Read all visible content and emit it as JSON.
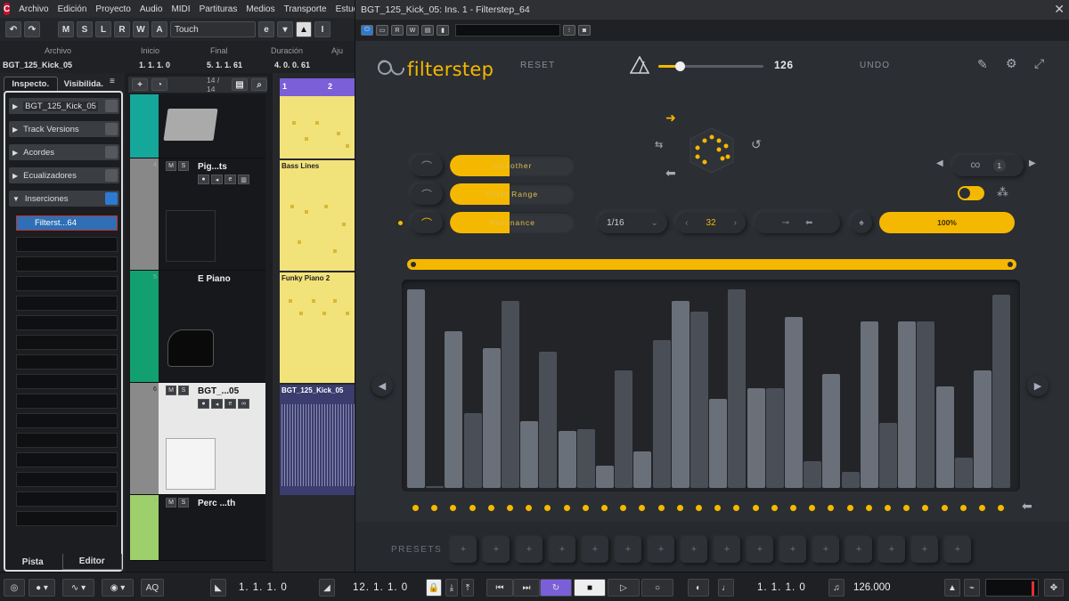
{
  "menu": {
    "items": [
      "Archivo",
      "Edición",
      "Proyecto",
      "Audio",
      "MIDI",
      "Partituras",
      "Medios",
      "Transporte",
      "Estud"
    ]
  },
  "toolbar": {
    "buttons": [
      "M",
      "S",
      "L",
      "R",
      "W",
      "A"
    ],
    "automation_mode": "Touch"
  },
  "infoline": {
    "headers": [
      "Archivo",
      "Inicio",
      "Final",
      "Duración",
      "Aju"
    ],
    "values": [
      "BGT_125_Kick_05",
      "1. 1. 1.   0",
      "5. 1. 1.  61",
      "4. 0. 0.  61",
      ""
    ]
  },
  "inspector": {
    "tab_active": "Inspecto.",
    "tab_other": "Visibilida.",
    "track_name": "BGT_125_Kick_05",
    "sections": [
      "Track Versions",
      "Acordes",
      "Ecualizadores",
      "Inserciones"
    ],
    "insert_slot": "Filterst...64",
    "footer": [
      "Pista",
      "Editor"
    ]
  },
  "tracklist": {
    "counter": "14 / 14",
    "tracks": [
      {
        "num": "",
        "name": ""
      },
      {
        "num": "4",
        "name": "Pig...ts"
      },
      {
        "num": "5",
        "name": "E Piano"
      },
      {
        "num": "6",
        "name": "BGT_...05"
      },
      {
        "num": "7",
        "name": "Perc ...th"
      }
    ]
  },
  "arrange": {
    "ruler": [
      "1",
      "2"
    ],
    "parts": [
      "",
      "Bass Lines",
      "Funky Piano 2",
      "BGT_125_Kick_05"
    ]
  },
  "plugin": {
    "title": "BGT_125_Kick_05: Ins. 1 - Filterstep_64",
    "brand": "filterstep",
    "reset": "RESET",
    "undo": "UNDO",
    "tempo": "126",
    "tempo_fraction": 0.2,
    "mods": [
      {
        "label": "Smoother",
        "fill": 0.48
      },
      {
        "label": "Filter Range",
        "fill": 0.48
      },
      {
        "label": "Resonance",
        "fill": 0.48
      }
    ],
    "rate": "1/16",
    "steps": "32",
    "amount": "100%",
    "page": "1",
    "bars": [
      0.98,
      0.0,
      0.77,
      0.37,
      0.69,
      0.92,
      0.33,
      0.67,
      0.28,
      0.29,
      0.11,
      0.58,
      0.18,
      0.73,
      0.92,
      0.87,
      0.44,
      0.98,
      0.49,
      0.49,
      0.84,
      0.13,
      0.56,
      0.08,
      0.82,
      0.32,
      0.82,
      0.82,
      0.5,
      0.15,
      0.58,
      0.95
    ],
    "presets_label": "PRESETS",
    "preset_slots": 16,
    "colors": {
      "accent": "#f5b800",
      "bg": "#2b2e33",
      "bar": "#4a4f57",
      "bar_light": "#6a7079"
    }
  },
  "transport": {
    "left_locator": "1. 1. 1.   0",
    "right_locator": "12. 1. 1.   0",
    "position": "1. 1. 1.   0",
    "tempo": "126.000",
    "aq": "AQ"
  }
}
